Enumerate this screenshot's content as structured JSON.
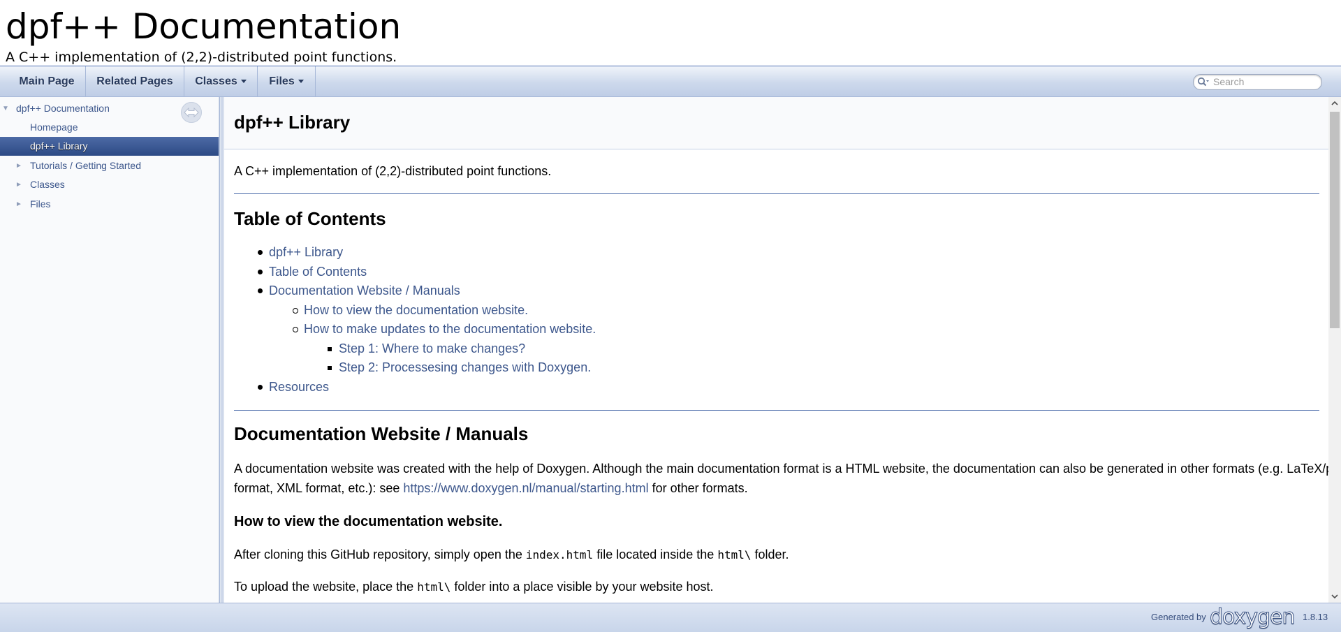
{
  "project": {
    "name": "dpf++ Documentation",
    "brief": "A C++ implementation of (2,2)-distributed point functions."
  },
  "navbar": {
    "items": [
      {
        "label": "Main Page",
        "dropdown": false
      },
      {
        "label": "Related Pages",
        "dropdown": false
      },
      {
        "label": "Classes",
        "dropdown": true
      },
      {
        "label": "Files",
        "dropdown": true
      }
    ],
    "search_placeholder": "Search"
  },
  "sidebar": {
    "items": [
      {
        "label": "dpf++ Documentation",
        "arrow": "▼",
        "selected": false
      },
      {
        "label": "Homepage",
        "arrow": "",
        "selected": false
      },
      {
        "label": "dpf++ Library",
        "arrow": "",
        "selected": true
      },
      {
        "label": "Tutorials / Getting Started",
        "arrow": "►",
        "selected": false
      },
      {
        "label": "Classes",
        "arrow": "►",
        "selected": false
      },
      {
        "label": "Files",
        "arrow": "►",
        "selected": false
      }
    ]
  },
  "main": {
    "title": "dpf++ Library",
    "intro": "A C++ implementation of (2,2)-distributed point functions.",
    "toc": {
      "heading": "Table of Contents",
      "items": [
        "dpf++ Library",
        "Table of Contents",
        "Documentation Website / Manuals",
        "How to view the documentation website.",
        "How to make updates to the documentation website.",
        "Step 1: Where to make changes?",
        "Step 2: Processesing changes with Doxygen.",
        "Resources"
      ]
    },
    "docs_section": {
      "heading": "Documentation Website / Manuals",
      "para_line1": "A documentation website was created with the help of Doxygen. Although the main documentation format is a HTML website, the documentation can also be generated in other formats (e.g. LaTeX/pdf",
      "para_line2_pre": "format, XML format, etc.): see ",
      "link": "https://www.doxygen.nl/manual/starting.html",
      "para_line2_post": " for other formats."
    },
    "view_section": {
      "heading": "How to view the documentation website.",
      "p1_pre": "After cloning this GitHub repository, simply open the ",
      "p1_code1": "index.html",
      "p1_mid": " file located inside the ",
      "p1_code2": "html\\",
      "p1_post": " folder.",
      "p2_pre": "To upload the website, place the ",
      "p2_code": "html\\",
      "p2_post": " folder into a place visible by your website host."
    }
  },
  "footer": {
    "generated_by": "Generated by",
    "logo": "doxygen",
    "version": "1.8.13"
  },
  "colors": {
    "link": "#3d578c",
    "selected_bg": "#3b5998",
    "rule": "#4a6aaa"
  }
}
